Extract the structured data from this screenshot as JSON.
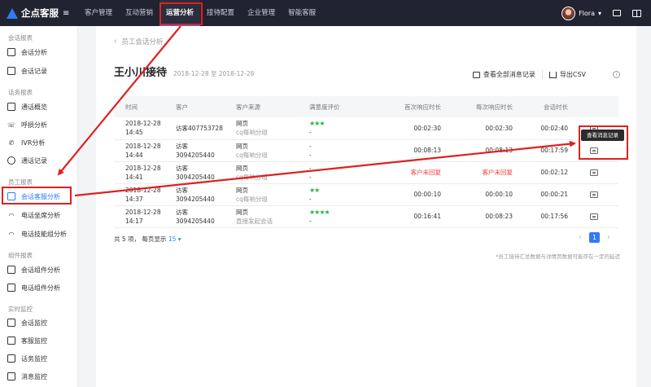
{
  "app": {
    "name": "企点客服",
    "menu_glyph": "≡"
  },
  "nav": {
    "items": [
      "客户管理",
      "互动营销",
      "运营分析",
      "接待配置",
      "企业管理",
      "智能客服"
    ],
    "active_index": 2
  },
  "user": {
    "name": "Flora",
    "caret": "▾"
  },
  "sidebar": {
    "sections": [
      {
        "title": "会话报表",
        "items": [
          {
            "label": "会话分析",
            "icon": "chart-box-icon"
          },
          {
            "label": "会话记录",
            "icon": "message-icon"
          }
        ]
      },
      {
        "title": "话务报表",
        "items": [
          {
            "label": "通话概览",
            "icon": "grid-icon"
          },
          {
            "label": "呼损分析",
            "icon": "phone-missed-icon"
          },
          {
            "label": "IVR分析",
            "icon": "ivr-icon"
          },
          {
            "label": "通话记录",
            "icon": "clock-icon"
          }
        ]
      },
      {
        "title": "员工报表",
        "items": [
          {
            "label": "会话客服分析",
            "icon": "chat-agent-icon"
          },
          {
            "label": "电话坐席分析",
            "icon": "headset-icon"
          },
          {
            "label": "电话技能组分析",
            "icon": "headset-group-icon"
          }
        ]
      },
      {
        "title": "组件报表",
        "items": [
          {
            "label": "会话组件分析",
            "icon": "widget-chat-icon"
          },
          {
            "label": "电话组件分析",
            "icon": "widget-phone-icon"
          }
        ]
      },
      {
        "title": "实时监控",
        "items": [
          {
            "label": "会话监控",
            "icon": "monitor-chat-icon"
          },
          {
            "label": "客服监控",
            "icon": "monitor-agent-icon"
          },
          {
            "label": "话务监控",
            "icon": "monitor-call-icon"
          },
          {
            "label": "消息监控",
            "icon": "monitor-msg-icon"
          }
        ]
      }
    ]
  },
  "page": {
    "breadcrumb": "员工会话分析",
    "breadcrumb_back": "‹",
    "title": "王小川接待",
    "date_range": "2018-12-28 至 2018-12-28",
    "actions": {
      "view_all": "查看全部消息记录",
      "export": "导出CSV"
    },
    "info_glyph": "i"
  },
  "table": {
    "headers": [
      "时间",
      "客户",
      "客户来源",
      "满意度评价",
      "首次响应时长",
      "每次响应时长",
      "会话时长",
      ""
    ],
    "rows": [
      {
        "date": "2018-12-28",
        "time": "14:45",
        "customer": "访客407753728",
        "source": "网页",
        "source_sub": "cq每响分组",
        "stars": "★★★",
        "rating_sub": "-",
        "first": "00:02:30",
        "each": "00:02:30",
        "duration": "00:02:40"
      },
      {
        "date": "2018-12-28",
        "time": "14:44",
        "customer": "访客3094205440",
        "source": "网页",
        "source_sub": "cq每响分组",
        "stars": "",
        "rating_sub": "-",
        "rating_main": "-",
        "first": "00:08:13",
        "each": "00:08:13",
        "duration": "00:17:59"
      },
      {
        "date": "2018-12-28",
        "time": "14:41",
        "customer": "访客3094205440",
        "source": "网页",
        "source_sub": "cq每响分组",
        "stars": "",
        "rating_sub": "-",
        "rating_main": "-",
        "first": "客户未回复",
        "each": "客户未回复",
        "duration": "00:02:12",
        "missed": true
      },
      {
        "date": "2018-12-28",
        "time": "14:37",
        "customer": "访客3094205440",
        "source": "网页",
        "source_sub": "cq每响分组",
        "stars": "★★",
        "rating_sub": "-",
        "first": "00:00:10",
        "each": "00:00:10",
        "duration": "00:00:21"
      },
      {
        "date": "2018-12-28",
        "time": "14:17",
        "customer": "访客3094205440",
        "source": "网页",
        "source_sub": "直接发起会话",
        "stars": "★★★★",
        "rating_sub": "-",
        "first": "00:16:41",
        "each": "00:08:23",
        "duration": "00:17:56"
      }
    ]
  },
  "footer": {
    "total_prefix": "共 5 项， 每页显示 ",
    "page_size": "15 ▾",
    "page": "1",
    "prev": "‹",
    "next": "›",
    "note": "*员工接待汇总数据与详情页数据可能存在一定的延迟"
  },
  "tooltip": "查看消息记录",
  "colors": {
    "accent": "#2f7cf6",
    "topbar": "#212330",
    "highlight": "#e02020",
    "star": "#2ab04a",
    "missed": "#f23c3c"
  }
}
